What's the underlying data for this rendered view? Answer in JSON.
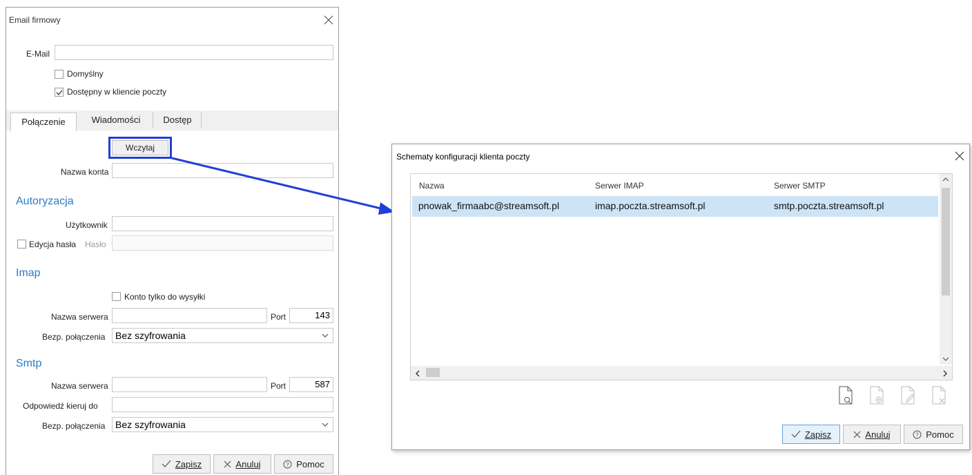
{
  "email_dialog": {
    "title": "Email firmowy",
    "email_label": "E-Mail",
    "email_value": "",
    "default_checkbox": {
      "label": "Domyślny",
      "checked": false
    },
    "client_checkbox": {
      "label": "Dostępny w kliencie poczty",
      "checked": true
    },
    "tabs": [
      {
        "label": "Połączenie",
        "active": true
      },
      {
        "label": "Wiadomości",
        "active": false
      },
      {
        "label": "Dostęp",
        "active": false
      }
    ],
    "load_button": "Wczytaj",
    "account_name_label": "Nazwa konta",
    "auth": {
      "heading": "Autoryzacja",
      "user_label": "Użytkownik",
      "edit_password_label": "Edycja hasła",
      "password_label": "Hasło"
    },
    "imap": {
      "heading": "Imap",
      "send_only_label": "Konto tylko do wysyłki",
      "server_label": "Nazwa serwera",
      "port_label": "Port",
      "port_value": "143",
      "security_label": "Bezp. połączenia",
      "security_value": "Bez szyfrowania"
    },
    "smtp": {
      "heading": "Smtp",
      "server_label": "Nazwa serwera",
      "port_label": "Port",
      "port_value": "587",
      "reply_to_label": "Odpowiedź kieruj do",
      "security_label": "Bezp. połączenia",
      "security_value": "Bez szyfrowania"
    },
    "buttons": {
      "save": "Zapisz",
      "cancel": "Anuluj",
      "help": "Pomoc"
    }
  },
  "schema_dialog": {
    "title": "Schematy konfiguracji klienta poczty",
    "columns": [
      "Nazwa",
      "Serwer IMAP",
      "Serwer SMTP"
    ],
    "rows": [
      {
        "name": "pnowak_firmaabc@streamsoft.pl",
        "imap": "imap.poczta.streamsoft.pl",
        "smtp": "smtp.poczta.streamsoft.pl",
        "selected": true
      }
    ],
    "toolbar_icons": [
      "preview-doc-icon",
      "add-doc-icon",
      "edit-doc-icon",
      "delete-doc-icon"
    ],
    "buttons": {
      "save": "Zapisz",
      "cancel": "Anuluj",
      "help": "Pomoc"
    }
  },
  "colors": {
    "accent": "#2b7bc4",
    "highlight_box": "#1f3fd8",
    "arrow": "#1f3fd8",
    "selected_row": "#cde4f7"
  }
}
